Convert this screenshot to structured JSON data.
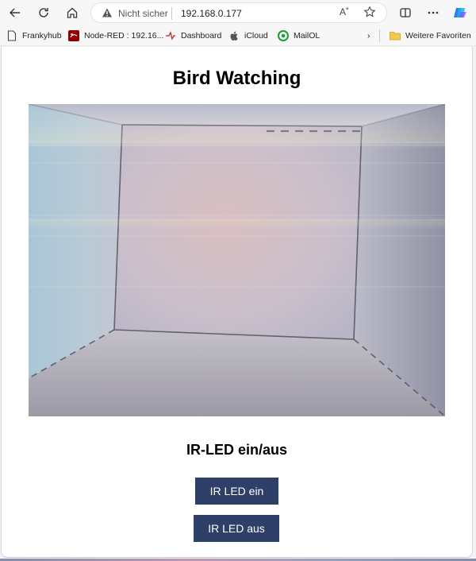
{
  "browser": {
    "address": {
      "security_label": "Nicht sicher",
      "url": "192.168.0.177",
      "read_aloud_label": "A˚"
    },
    "icons": [
      "back-icon",
      "refresh-icon",
      "home-icon",
      "warning-icon",
      "read-aloud-icon",
      "favorite-star-icon",
      "split-screen-icon",
      "more-icon",
      "copilot-icon"
    ]
  },
  "bookmarks": [
    {
      "label": "Frankyhub",
      "icon": "page-icon"
    },
    {
      "label": "Node-RED : 192.16...",
      "icon": "node-red-icon"
    },
    {
      "label": "Dashboard",
      "icon": "dashboard-icon"
    },
    {
      "label": "iCloud",
      "icon": "apple-icon"
    },
    {
      "label": "MailOL",
      "icon": "mail-icon"
    }
  ],
  "bookmarks_more": "›",
  "bookmarks_folder": {
    "label": "Weitere Favoriten",
    "icon": "folder-icon"
  },
  "page": {
    "title": "Bird Watching",
    "camera_feed": "camera-stream-image",
    "section_title": "IR-LED ein/aus",
    "buttons": {
      "on": "IR LED ein",
      "off": "IR LED aus"
    }
  },
  "colors": {
    "button_bg": "#2e4068",
    "button_text": "#ffffff",
    "copilot": "#3b82f6"
  }
}
